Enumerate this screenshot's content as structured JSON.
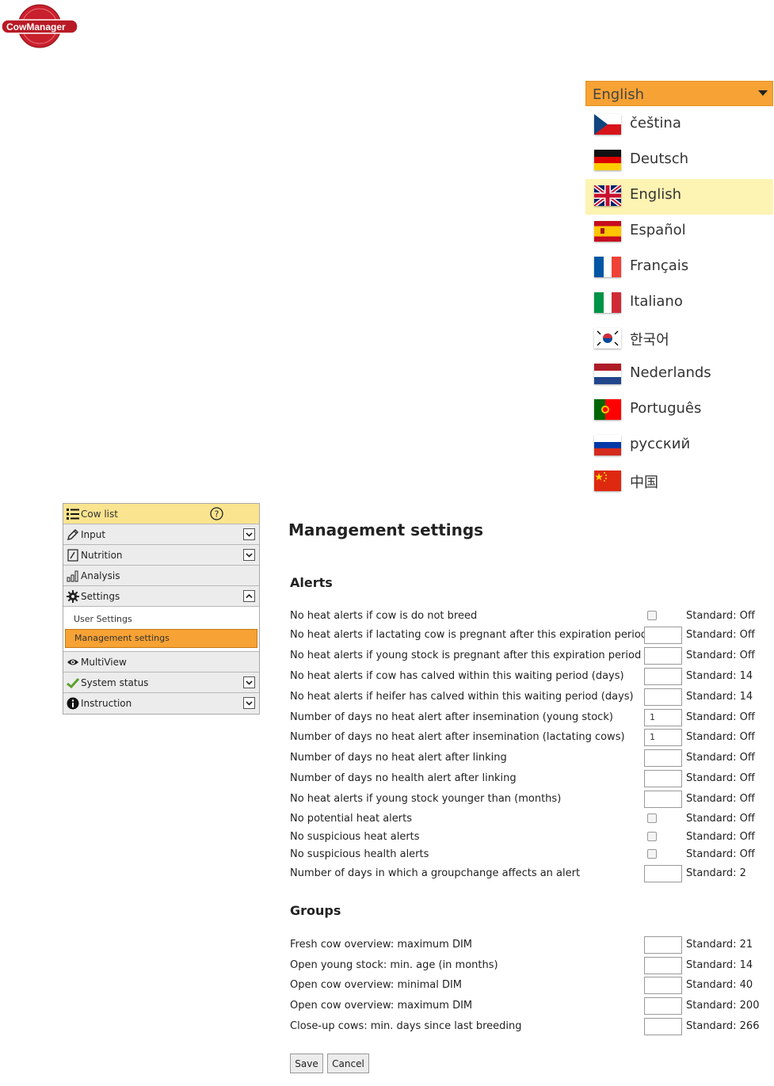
{
  "logo": {
    "text": "CowManager"
  },
  "language": {
    "selected": "English",
    "options": [
      "čeština",
      "Deutsch",
      "English",
      "Español",
      "Français",
      "Italiano",
      "한국어",
      "Nederlands",
      "Português",
      "русский",
      "中国"
    ]
  },
  "sidebar": {
    "cow_list": "Cow list",
    "input": "Input",
    "nutrition": "Nutrition",
    "analysis": "Analysis",
    "settings": "Settings",
    "user_settings": "User Settings",
    "management_settings": "Management settings",
    "multiview": "MultiView",
    "system_status": "System status",
    "instruction": "Instruction"
  },
  "main": {
    "title": "Management settings",
    "alerts_title": "Alerts",
    "groups_title": "Groups",
    "alerts": [
      {
        "label": "No heat alerts if cow is do not breed",
        "control": "checkbox",
        "value": "",
        "standard": "Standard: Off"
      },
      {
        "label": "No heat alerts if lactating cow is pregnant after this expiration period",
        "control": "input",
        "value": "",
        "standard": "Standard: Off"
      },
      {
        "label": "No heat alerts if young stock is pregnant after this expiration period",
        "control": "input",
        "value": "",
        "standard": "Standard: Off"
      },
      {
        "label": "No heat alerts if cow has calved within this waiting period (days)",
        "control": "input",
        "value": "",
        "standard": "Standard: 14"
      },
      {
        "label": "No heat alerts if heifer has calved within this waiting period (days)",
        "control": "input",
        "value": "",
        "standard": "Standard: 14"
      },
      {
        "label": "Number of days no heat alert after insemination (young stock)",
        "control": "input",
        "value": "1",
        "standard": "Standard: Off"
      },
      {
        "label": "Number of days no heat alert after insemination (lactating cows)",
        "control": "input",
        "value": "1",
        "standard": "Standard: Off"
      },
      {
        "label": "Number of days no heat alert after linking",
        "control": "input",
        "value": "",
        "standard": "Standard: Off"
      },
      {
        "label": "Number of days no health alert after linking",
        "control": "input",
        "value": "",
        "standard": "Standard: Off"
      },
      {
        "label": "No heat alerts if young stock younger than (months)",
        "control": "input",
        "value": "",
        "standard": "Standard: Off"
      },
      {
        "label": "No potential heat alerts",
        "control": "checkbox",
        "value": "",
        "standard": "Standard: Off"
      },
      {
        "label": "No suspicious heat alerts",
        "control": "checkbox",
        "value": "",
        "standard": "Standard: Off"
      },
      {
        "label": "No suspicious health alerts",
        "control": "checkbox",
        "value": "",
        "standard": "Standard: Off"
      },
      {
        "label": "Number of days in which a groupchange affects an alert",
        "control": "input",
        "value": "",
        "standard": "Standard: 2"
      }
    ],
    "groups": [
      {
        "label": "Fresh cow overview: maximum DIM",
        "control": "input",
        "value": "",
        "standard": "Standard: 21"
      },
      {
        "label": "Open young stock: min. age (in months)",
        "control": "input",
        "value": "",
        "standard": "Standard: 14"
      },
      {
        "label": "Open cow overview: minimal DIM",
        "control": "input",
        "value": "",
        "standard": "Standard: 40"
      },
      {
        "label": "Open cow overview: maximum DIM",
        "control": "input",
        "value": "",
        "standard": "Standard: 200"
      },
      {
        "label": "Close-up cows: min. days since last breeding",
        "control": "input",
        "value": "",
        "standard": "Standard: 266"
      }
    ],
    "save": "Save",
    "cancel": "Cancel"
  },
  "colors": {
    "accent": "#f7a234",
    "active_nav": "#fbe48f",
    "selected_lang": "#fdf3b3",
    "logo_red": "#c8202c"
  }
}
